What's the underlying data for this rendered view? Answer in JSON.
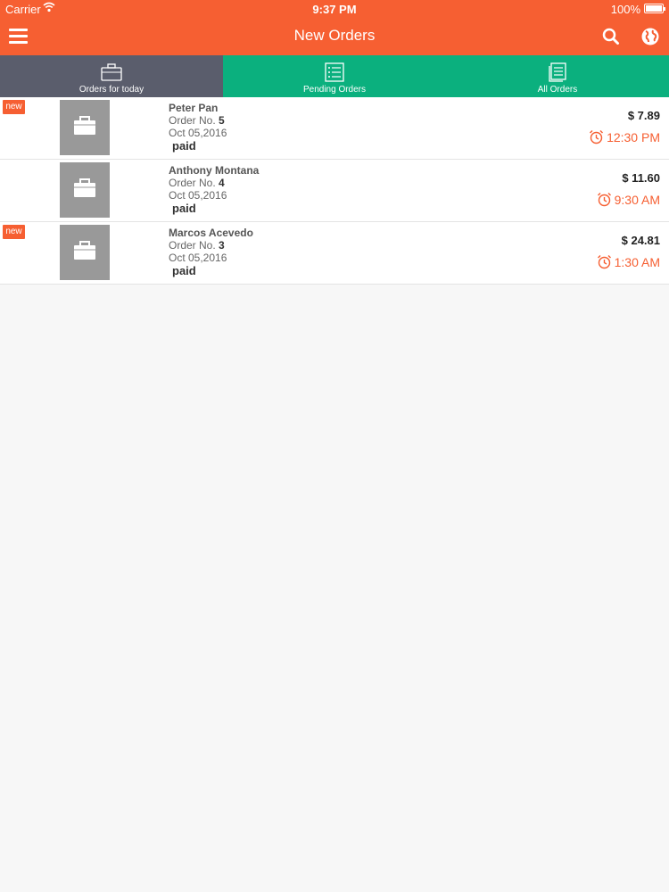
{
  "status_bar": {
    "carrier": "Carrier",
    "time": "9:37 PM",
    "battery": "100%"
  },
  "navbar": {
    "title": "New Orders",
    "left_icon": "menu-icon",
    "right_icons": [
      "search-icon",
      "globe-icon"
    ]
  },
  "colors": {
    "accent": "#f65f32",
    "active_tab": "#5a5d6c",
    "inactive_tab": "#0bb07e"
  },
  "tabs": [
    {
      "label": "Orders for today",
      "icon": "briefcase-icon",
      "active": true
    },
    {
      "label": "Pending Orders",
      "icon": "list-icon",
      "active": false
    },
    {
      "label": "All Orders",
      "icon": "documents-icon",
      "active": false
    }
  ],
  "orders": [
    {
      "badge": "new",
      "name": "Peter Pan",
      "order_prefix": "Order No.",
      "order_no": "5",
      "date": "Oct 05,2016",
      "status": "paid",
      "amount": "$ 7.89",
      "time": "12:30 PM"
    },
    {
      "badge": "",
      "name": "Anthony Montana",
      "order_prefix": "Order No.",
      "order_no": "4",
      "date": "Oct 05,2016",
      "status": "paid",
      "amount": "$ 11.60",
      "time": "9:30 AM"
    },
    {
      "badge": "new",
      "name": "Marcos Acevedo",
      "order_prefix": "Order No.",
      "order_no": "3",
      "date": "Oct 05,2016",
      "status": "paid",
      "amount": "$ 24.81",
      "time": "1:30 AM"
    }
  ]
}
